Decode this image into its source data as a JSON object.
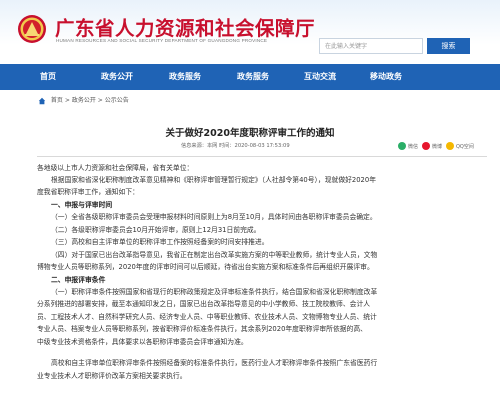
{
  "header": {
    "title": "广东省人力资源和社会保障厅",
    "subtitle": "HUMAN RESOURCES AND SOCIAL SECURITY DEPARTMENT OF GUANGDONG PROVINCE",
    "emblem_icon": "guangdong-emblem-icon",
    "search_placeholder": "在此输入关键字",
    "search_button": "搜索",
    "colors": {
      "title": "#c8102e",
      "accent": "#1f63b5"
    }
  },
  "nav": {
    "items": [
      {
        "label": "首页"
      },
      {
        "label": "政务公开"
      },
      {
        "label": "政务服务"
      },
      {
        "label": "政务服务"
      },
      {
        "label": "互动交流"
      },
      {
        "label": "移动政务"
      }
    ]
  },
  "breadcrumb": {
    "icon": "home-icon",
    "items": [
      "首页",
      "政务公开",
      "公示公告"
    ],
    "separator": ">"
  },
  "article": {
    "title": "关于做好2020年度职称评审工作的通知",
    "meta": "信息来源：本网    时间：2020-08-03 17:53:09",
    "share": [
      {
        "label": "微信",
        "icon": "wechat-icon",
        "color": "#2aae67"
      },
      {
        "label": "微博",
        "icon": "weibo-icon",
        "color": "#e6162d"
      },
      {
        "label": "QQ空间",
        "icon": "qzone-icon",
        "color": "#f5b800"
      }
    ],
    "lines": [
      {
        "text": "各地级以上市人力资源和社会保障局，省有关单位：",
        "indent": 0,
        "heading": false
      },
      {
        "text": "根据国家和省深化职称制度改革意见精神和《职称评审管理暂行规定》（人社部令第40号），现就做好2020年",
        "indent": 2,
        "heading": false
      },
      {
        "text": "度我省职称评审工作，通知如下：",
        "indent": 0,
        "heading": false
      },
      {
        "text": "一、申报与评审时间",
        "indent": 2,
        "heading": true
      },
      {
        "text": "（一）全省各级职称评审委员会受理申报材料时间原则上为8月至10月，具体时间由各职称评审委员会确定。",
        "indent": 2,
        "heading": false
      },
      {
        "text": "（二）各级职称评审委员会10月开始评审，原则上12月31日前完成。",
        "indent": 2,
        "heading": false
      },
      {
        "text": "（三）高校和自主评审单位的职称评审工作按照经备案的时间安排推进。",
        "indent": 2,
        "heading": false
      },
      {
        "text": "（四）对于国家已出台改革指导意见，我省正在制定出台改革实施方案的中等职业教师，统计专业人员，文物",
        "indent": 2,
        "heading": false
      },
      {
        "text": "博物专业人员等职称系列，2020年度的评审时间可以后顺延，待省出台实施方案和标准条件后再组织开展评审。",
        "indent": 0,
        "heading": false
      },
      {
        "text": "二、申报评审条件",
        "indent": 2,
        "heading": true
      },
      {
        "text": "（一）职称评审条件按照国家和省现行的职称政策规定及评审标准条件执行，结合国家和省深化职称制度改革",
        "indent": 2,
        "heading": false
      },
      {
        "text": "分系列推进的部署安排，截至本通知印发之日，国家已出台改革指导意见的中小学教师、技工院校教师、会计人",
        "indent": 0,
        "heading": false
      },
      {
        "text": "员、工程技术人才、自然科学研究人员、经济专业人员、中等职业教师、农业技术人员、文物博物专业人员、统计",
        "indent": 0,
        "heading": false
      },
      {
        "text": "专业人员、档案专业人员等职称系列，按省职称评价标准条件执行，其余系列2020年度职称评审所依据的高、",
        "indent": 0,
        "heading": false
      },
      {
        "text": "中级专业技术资格条件，具体要求以各职称评审委员会评审通知为准。",
        "indent": 0,
        "heading": false
      },
      {
        "text": "高校和自主评审单位职称评审条件按照经备案的标准条件执行，医药行业人才职称评审条件按照广东省医药行",
        "indent": 2,
        "heading": false
      },
      {
        "text": "业专业技术人才职称评价改革方案相关要求执行。",
        "indent": 0,
        "heading": false
      }
    ]
  }
}
